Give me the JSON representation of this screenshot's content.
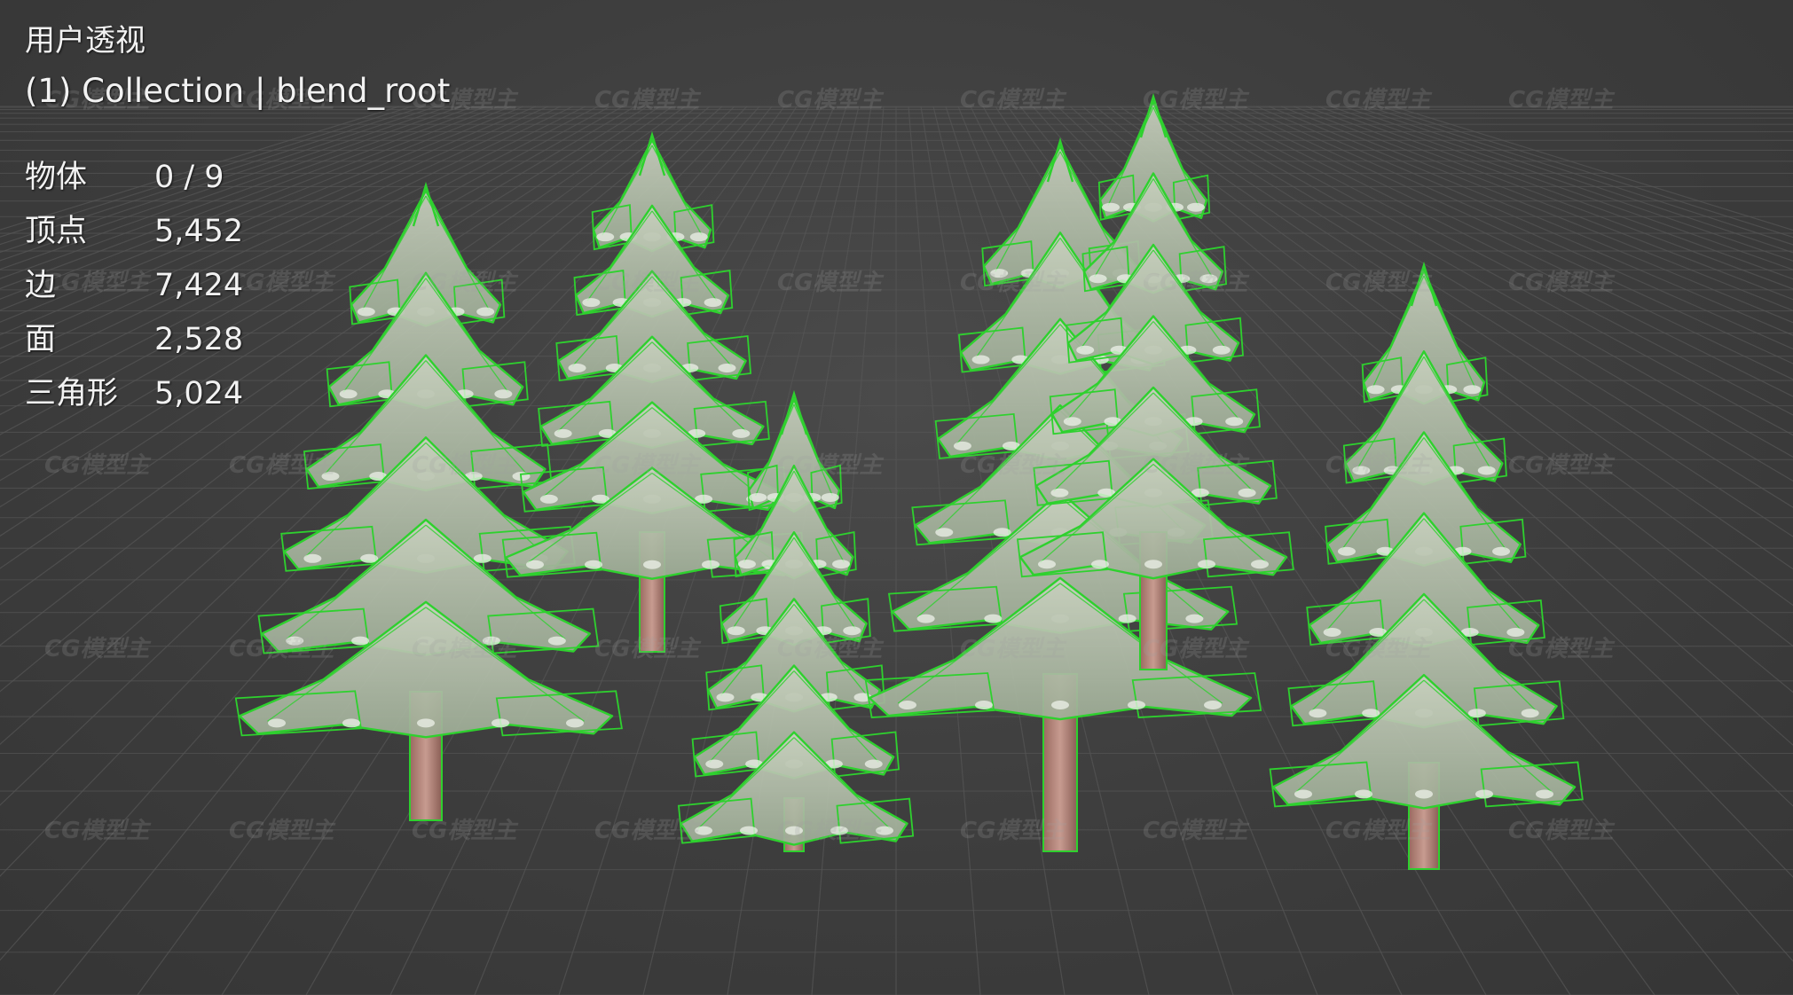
{
  "viewport": {
    "view_label": "用户透视",
    "collection_label": "(1) Collection | blend_root"
  },
  "stats": [
    {
      "label": "物体",
      "value": "0 / 9"
    },
    {
      "label": "顶点",
      "value": "5,452"
    },
    {
      "label": "边",
      "value": "7,424"
    },
    {
      "label": "面",
      "value": "2,528"
    },
    {
      "label": "三角形",
      "value": "5,024"
    }
  ],
  "watermark_text": "CG模型主",
  "colors": {
    "background": "#3d3d3d",
    "grid_line": "#555555",
    "wireframe": "#2ed12e",
    "foliage": "#b7c2ad",
    "trunk": "#b98a7f"
  }
}
